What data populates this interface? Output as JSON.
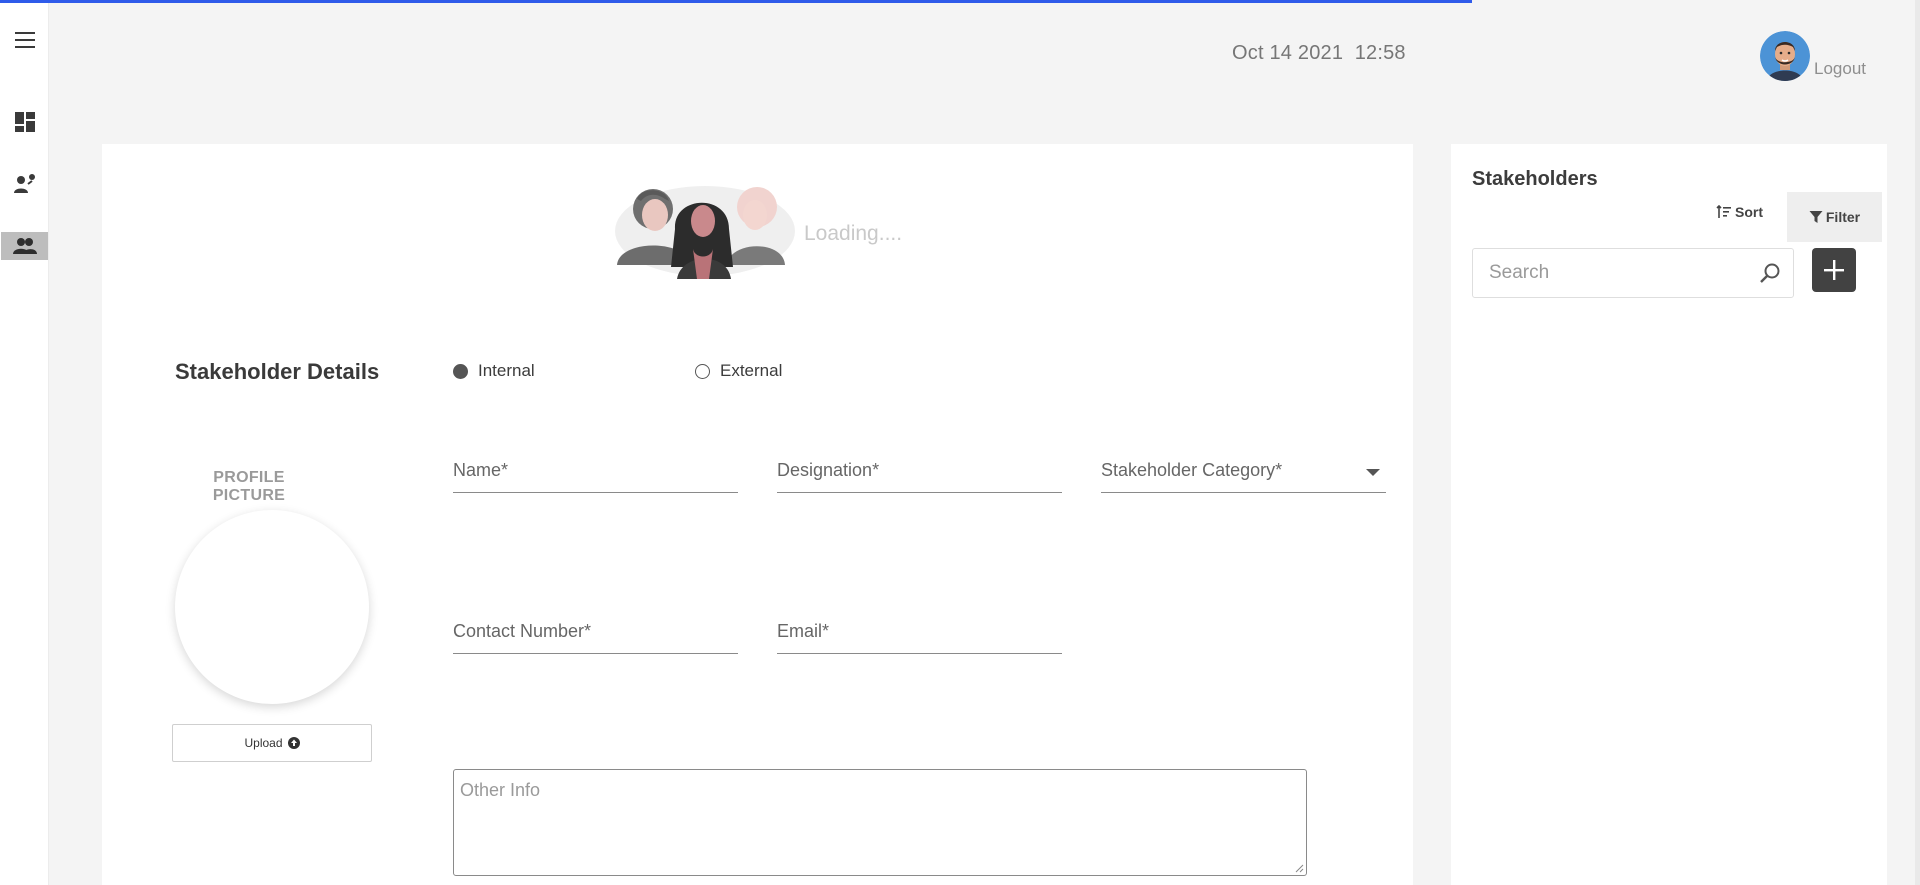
{
  "header": {
    "date": "Oct 14 2021",
    "time": "12:58",
    "logout_label": "Logout"
  },
  "sidebar": {
    "items": [
      {
        "icon": "menu-icon"
      },
      {
        "icon": "dashboard-icon"
      },
      {
        "icon": "person-add-icon"
      },
      {
        "icon": "people-icon",
        "active": true
      }
    ]
  },
  "main": {
    "loading_text": "Loading....",
    "details_title": "Stakeholder Details",
    "type_options": [
      {
        "label": "Internal",
        "selected": true
      },
      {
        "label": "External",
        "selected": false
      }
    ],
    "profile_picture_label": "PROFILE PICTURE",
    "upload_label": "Upload",
    "fields": {
      "name": "Name*",
      "designation": "Designation*",
      "category": "Stakeholder Category*",
      "contact": "Contact Number*",
      "email": "Email*",
      "other_info": "Other Info"
    }
  },
  "panel": {
    "title": "Stakeholders",
    "sort_label": "Sort",
    "filter_label": "Filter",
    "search_placeholder": "Search"
  },
  "colors": {
    "accent": "#2f5bea",
    "background": "#f4f4f4",
    "card": "#ffffff",
    "dark_button": "#424242"
  }
}
